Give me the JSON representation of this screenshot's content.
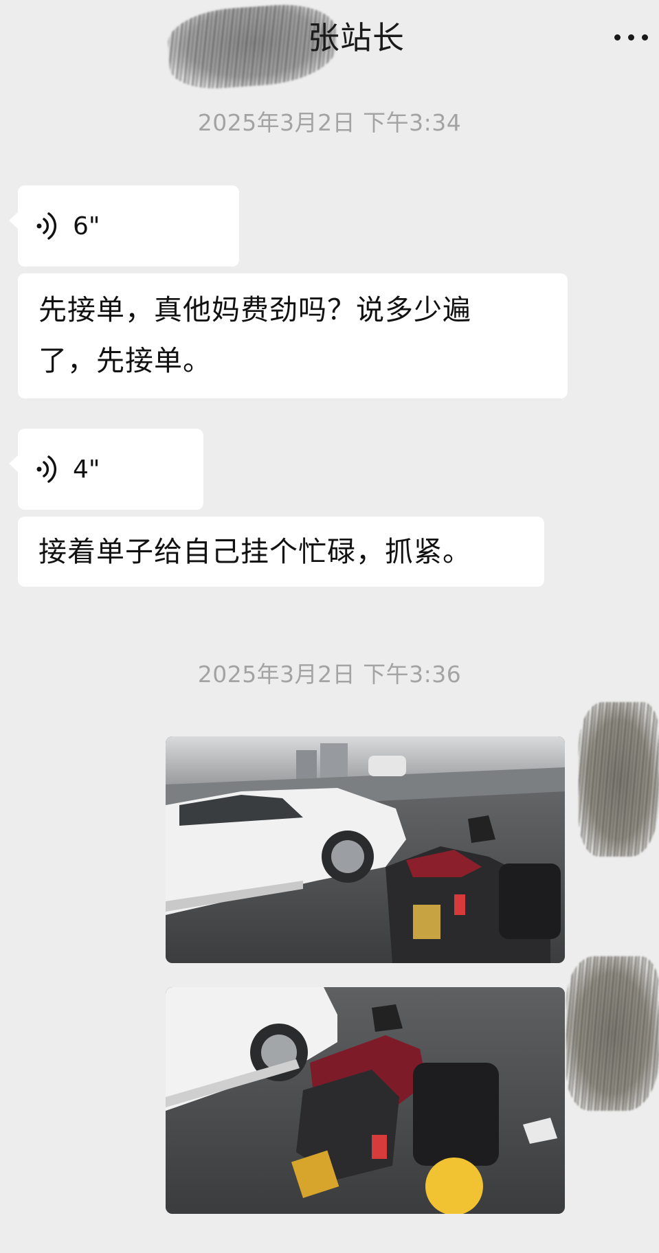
{
  "header": {
    "title_visible": "张站长",
    "more_icon": "more-icon"
  },
  "messages": [
    {
      "type": "timestamp",
      "text": "2025年3月2日 下午3:34"
    },
    {
      "type": "voice",
      "duration": "6\"",
      "icon": "voice-icon"
    },
    {
      "type": "text",
      "lines": [
        "先接单，真他妈费劲吗？说多少遍",
        "了，先接单。"
      ]
    },
    {
      "type": "voice",
      "duration": "4\"",
      "icon": "voice-icon"
    },
    {
      "type": "text",
      "lines": [
        "接着单子给自己挂个忙碌，抓紧。"
      ]
    },
    {
      "type": "timestamp",
      "text": "2025年3月2日 下午3:36"
    },
    {
      "type": "image",
      "subject": "photo of white SUV and red scooter on wet road"
    },
    {
      "type": "image",
      "subject": "photo of red scooter with yellow helmet next to white SUV"
    }
  ],
  "colors": {
    "background": "#ededed",
    "bubble": "#ffffff",
    "timestamp": "#a3a3a3",
    "text": "#111111"
  }
}
